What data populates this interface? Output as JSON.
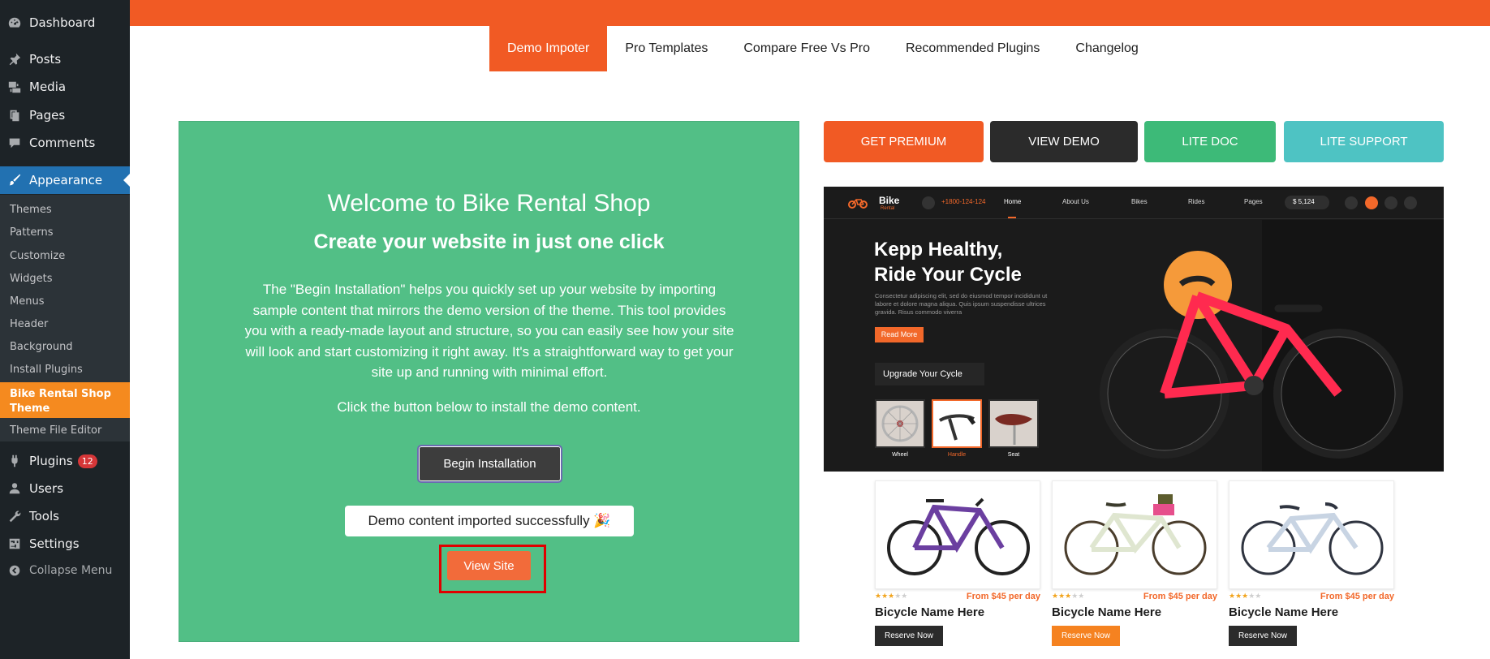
{
  "sidebar": {
    "top_items": [
      {
        "label": "Dashboard",
        "icon": "dashboard-icon"
      },
      {
        "label": "Posts",
        "icon": "pin-icon"
      },
      {
        "label": "Media",
        "icon": "media-icon"
      },
      {
        "label": "Pages",
        "icon": "pages-icon"
      },
      {
        "label": "Comments",
        "icon": "comment-icon"
      },
      {
        "label": "Appearance",
        "icon": "brush-icon"
      }
    ],
    "appearance_submenu": [
      "Themes",
      "Patterns",
      "Customize",
      "Widgets",
      "Menus",
      "Header",
      "Background",
      "Install Plugins"
    ],
    "current_subitem": "Bike Rental Shop Theme",
    "last_subitem": "Theme File Editor",
    "bottom_items": [
      {
        "label": "Plugins",
        "icon": "plug-icon",
        "badge": "12"
      },
      {
        "label": "Users",
        "icon": "user-icon"
      },
      {
        "label": "Tools",
        "icon": "wrench-icon"
      },
      {
        "label": "Settings",
        "icon": "settings-icon"
      }
    ],
    "collapse_label": "Collapse Menu"
  },
  "tabs": [
    "Demo Impoter",
    "Pro Templates",
    "Compare Free Vs Pro",
    "Recommended Plugins",
    "Changelog"
  ],
  "welcome": {
    "title": "Welcome to Bike Rental Shop",
    "subtitle": "Create your website in just one click",
    "description": "The \"Begin Installation\" helps you quickly set up your website by importing sample content that mirrors the demo version of the theme. This tool provides you with a ready-made layout and structure, so you can easily see how your site will look and start customizing it right away. It's a straightforward way to get your site up and running with minimal effort.",
    "hint": "Click the button below to install the demo content.",
    "begin_button": "Begin Installation",
    "success_message": "Demo content imported successfully 🎉",
    "view_site_button": "View Site"
  },
  "actions": [
    {
      "label": "GET PREMIUM",
      "color": "#f15a24"
    },
    {
      "label": "VIEW DEMO",
      "color": "#2b2b2b"
    },
    {
      "label": "LITE DOC",
      "color": "#3dba78"
    },
    {
      "label": "LITE SUPPORT",
      "color": "#4ec3c3"
    }
  ],
  "preview": {
    "logo": "Bike",
    "logo_sub": "Rental",
    "phone": "+1800-124-124",
    "nav": [
      "Home",
      "About Us",
      "Bikes",
      "Rides",
      "Pages"
    ],
    "cart": "$ 5,124",
    "hero_title": "Kepp Healthy,\nRide Your Cycle",
    "hero_text": "Consectetur adipiscing elit, sed do eiusmod tempor incididunt ut labore et dolore magna aliqua. Quis ipsum suspendisse ultrices gravida. Risus commodo viverra",
    "read_more": "Read More",
    "upgrade": "Upgrade Your Cycle",
    "parts": [
      "Wheel",
      "Handle",
      "Seat"
    ]
  },
  "products": [
    {
      "name": "Bicycle Name Here",
      "price": "From $45 per day",
      "rating": 3,
      "button": "Reserve Now",
      "frame_color": "#6b3fa0"
    },
    {
      "name": "Bicycle Name Here",
      "price": "From $45 per day",
      "rating": 3,
      "button": "Reserve Now",
      "frame_color": "#dfe6d0"
    },
    {
      "name": "Bicycle Name Here",
      "price": "From $45 per day",
      "rating": 3,
      "button": "Reserve Now",
      "frame_color": "#c8d4e3"
    }
  ]
}
